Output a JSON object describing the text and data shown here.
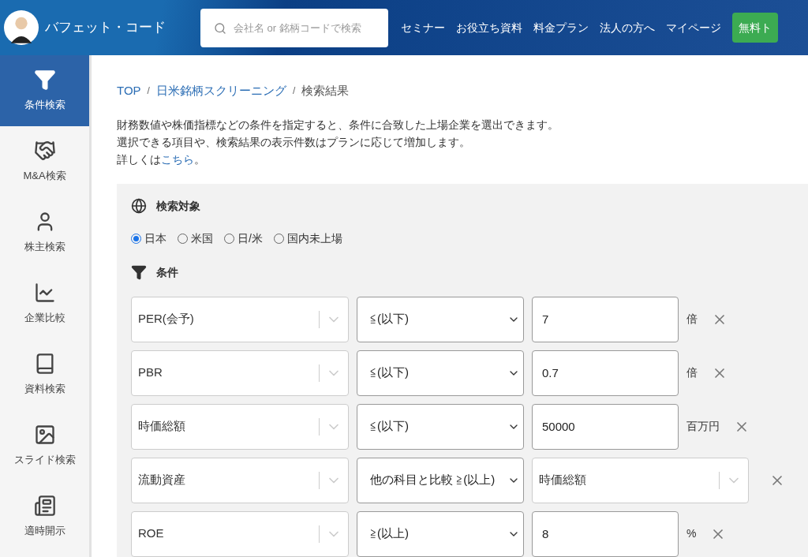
{
  "header": {
    "site_name": "バフェット・コード",
    "search": {
      "placeholder": "会社名 or 銘柄コードで検索"
    },
    "nav": [
      "セミナー",
      "お役立ち資料",
      "料金プラン",
      "法人の方へ",
      "マイページ"
    ],
    "cta": "無料ト"
  },
  "sidebar": {
    "items": [
      {
        "label": "条件検索",
        "selected": true
      },
      {
        "label": "M&A検索",
        "selected": false
      },
      {
        "label": "株主検索",
        "selected": false
      },
      {
        "label": "企業比較",
        "selected": false
      },
      {
        "label": "資料検索",
        "selected": false
      },
      {
        "label": "スライド検索",
        "selected": false
      },
      {
        "label": "適時開示",
        "selected": false
      }
    ]
  },
  "breadcrumb": {
    "separator": "/",
    "items": [
      {
        "label": "TOP",
        "link": true
      },
      {
        "label": "日米銘柄スクリーニング",
        "link": true
      },
      {
        "label": "検索結果",
        "link": false
      }
    ]
  },
  "intro": [
    "財務数値や株価指標などの条件を指定すると、条件に合致した上場企業を選出できます。",
    "選択できる項目や、検索結果の表示件数はプランに応じて増加します。"
  ],
  "detail": {
    "text": "詳しくは",
    "link": "こちら",
    "end": "。"
  },
  "target": {
    "title": "検索対象",
    "options": [
      {
        "label": "日本",
        "selected": true
      },
      {
        "label": "米国",
        "selected": false
      },
      {
        "label": "日/米",
        "selected": false
      },
      {
        "label": "国内未上場",
        "selected": false
      }
    ]
  },
  "conditions": {
    "title": "条件",
    "rows": [
      {
        "kind": "number",
        "item": "PER(会予)",
        "operator": "≦(以下)",
        "value": "7",
        "unit": "倍"
      },
      {
        "kind": "number",
        "item": "PBR",
        "operator": "≦(以下)",
        "value": "0.7",
        "unit": "倍"
      },
      {
        "kind": "number",
        "item": "時価総額",
        "operator": "≦(以下)",
        "value": "50000",
        "unit": "百万円"
      },
      {
        "kind": "compare",
        "item": "流動資産",
        "operator": "他の科目と比較 ≧(以上)",
        "value": "時価総額"
      },
      {
        "kind": "number",
        "item": "ROE",
        "operator": "≧(以上)",
        "value": "8",
        "unit": "%"
      }
    ]
  }
}
